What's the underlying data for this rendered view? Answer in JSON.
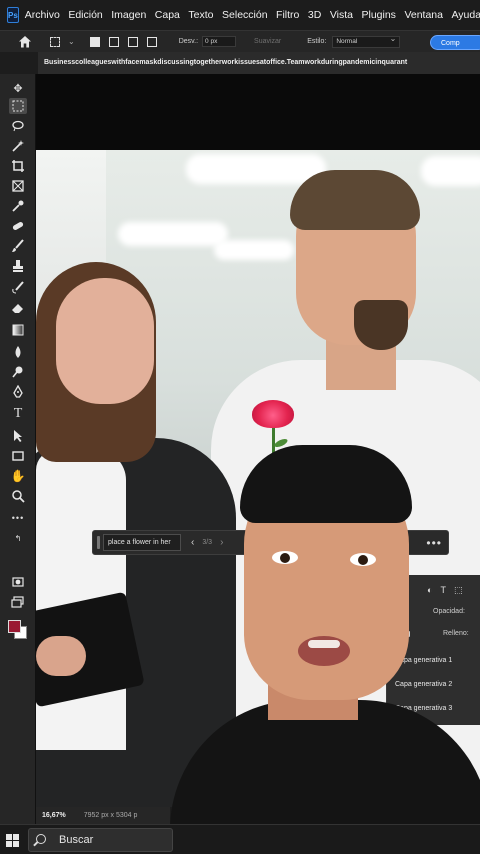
{
  "app": {
    "logo_text": "Ps"
  },
  "menu": [
    "Archivo",
    "Edición",
    "Imagen",
    "Capa",
    "Texto",
    "Selección",
    "Filtro",
    "3D",
    "Vista",
    "Plugins",
    "Ventana",
    "Ayuda"
  ],
  "options_bar": {
    "feather_label": "Desv.:",
    "feather_value": "0 px",
    "smooth_label": "Suavizar",
    "style_label": "Estilo:",
    "style_value": "Normal",
    "generate_button": "Comp"
  },
  "document": {
    "tab_title": "Businesscolleagueswithfacemaskdiscussingtogetherworkissuesatoffice.Teamworkduringpandemicinquarant"
  },
  "generative_bar": {
    "prompt_value": "place a flower in her",
    "page_indicator": "3/3",
    "prev_icon": "chevron-left-icon",
    "next_icon": "chevron-right-icon",
    "more_icon": "more-horizontal-icon"
  },
  "layers_panel": {
    "opacity_label": "Opacidad:",
    "fill_label": "Relleno:",
    "layers": [
      "Capa generativa 1",
      "Capa generativa 2",
      "Capa generativa 3"
    ]
  },
  "status_bar": {
    "zoom": "16,67%",
    "dimensions": "7952 px x 5304 p"
  },
  "taskbar": {
    "search_label": "Buscar"
  },
  "colors": {
    "foreground": "#9a1a33",
    "background": "#ffffff",
    "accent": "#2c7ae4"
  }
}
